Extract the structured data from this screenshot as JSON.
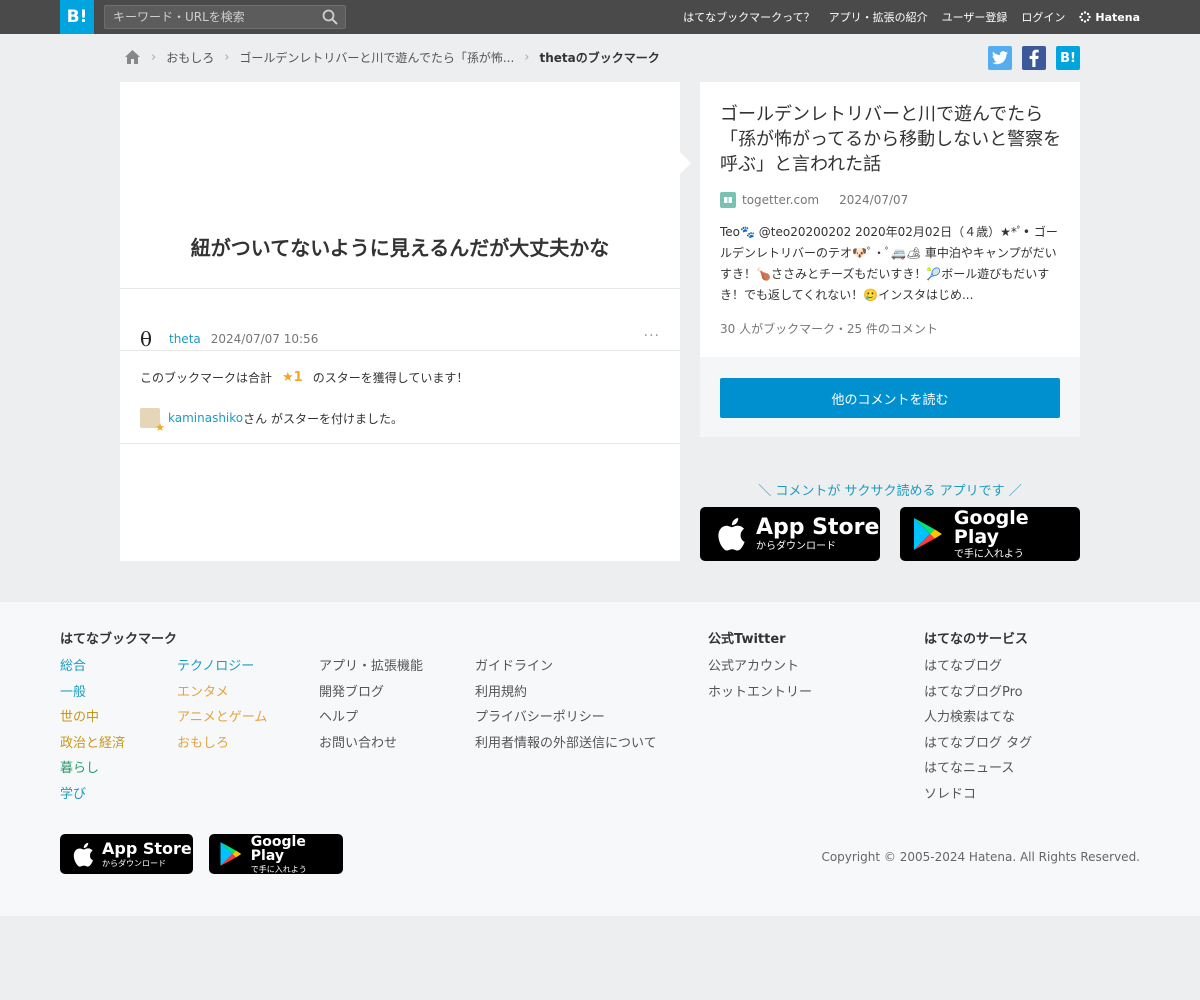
{
  "header": {
    "logo_label": "B!",
    "search_placeholder": "キーワード・URLを検索",
    "nav": [
      "はてなブックマークって？",
      "アプリ・拡張の紹介",
      "ユーザー登録",
      "ログイン"
    ],
    "brand": "Hatena"
  },
  "breadcrumb": {
    "items": [
      "おもしろ",
      "ゴールデンレトリバーと川で遊んでたら「孫が怖..."
    ],
    "current": "thetaのブックマーク"
  },
  "share": {
    "twitter_color": "#55acee",
    "facebook_color": "#3b5998",
    "hatena_color": "#00a4de",
    "hatena_label": "B!"
  },
  "bookmark": {
    "comment": "紐がついてないように見えるんだが大丈夫かな",
    "user_icon_glyph": "θ",
    "username": "theta",
    "timestamp": "2024/07/07 10:56",
    "more_label": "···",
    "star_prefix": "このブックマークは合計",
    "star_count": "★1",
    "star_suffix": "のスターを獲得しています！",
    "starrer_name": "kaminashiko",
    "starrer_suffix": "さん がスターを付けました。"
  },
  "entry": {
    "title": "ゴールデンレトリバーと川で遊んでたら「孫が怖がってるから移動しないと警察を呼ぶ」と言われた話",
    "site": "togetter.com",
    "date": "2024/07/07",
    "summary": "Teo🐾 @teo20200202 2020年02月02日（４歳）★*ﾟ• ゴールデンレトリバーのテオ🐶ﾟ•ﾟ🚐🏕 車中泊やキャンプがだいすき！🍗ささみとチーズもだいすき！🎾ボール遊びもだいすき！でも返してくれない！🥲インスタはじめ...",
    "count": "30 人がブックマーク・25 件のコメント",
    "read_button": "他のコメントを読む"
  },
  "promo": {
    "text": "＼ コメントが サクサク読める アプリです ／",
    "appstore_big": "App Store",
    "appstore_small": "からダウンロード",
    "googleplay_big": "Google Play",
    "googleplay_small": "で手に入れよう"
  },
  "footer": {
    "heading_main": "はてなブックマーク",
    "col1": [
      {
        "label": "総合",
        "color": "#1d9bbf"
      },
      {
        "label": "一般",
        "color": "#1d9bbf"
      },
      {
        "label": "世の中",
        "color": "#c9961a"
      },
      {
        "label": "政治と経済",
        "color": "#c9961a"
      },
      {
        "label": "暮らし",
        "color": "#2c9a6c"
      },
      {
        "label": "学び",
        "color": "#1d9bbf"
      }
    ],
    "col2": [
      {
        "label": "テクノロジー",
        "color": "#1d9bbf"
      },
      {
        "label": "エンタメ",
        "color": "#e6a23c"
      },
      {
        "label": "アニメとゲーム",
        "color": "#e6a23c"
      },
      {
        "label": "おもしろ",
        "color": "#e6a23c"
      }
    ],
    "col3": [
      "アプリ・拡張機能",
      "開発ブログ",
      "ヘルプ",
      "お問い合わせ"
    ],
    "col4": [
      "ガイドライン",
      "利用規約",
      "プライバシーポリシー",
      "利用者情報の外部送信について"
    ],
    "heading_twitter": "公式Twitter",
    "twitter_links": [
      "公式アカウント",
      "ホットエントリー"
    ],
    "heading_services": "はてなのサービス",
    "services": [
      "はてなブログ",
      "はてなブログPro",
      "人力検索はてな",
      "はてなブログ タグ",
      "はてなニュース",
      "ソレドコ"
    ],
    "copyright": "Copyright © 2005-2024 Hatena. All Rights Reserved."
  }
}
